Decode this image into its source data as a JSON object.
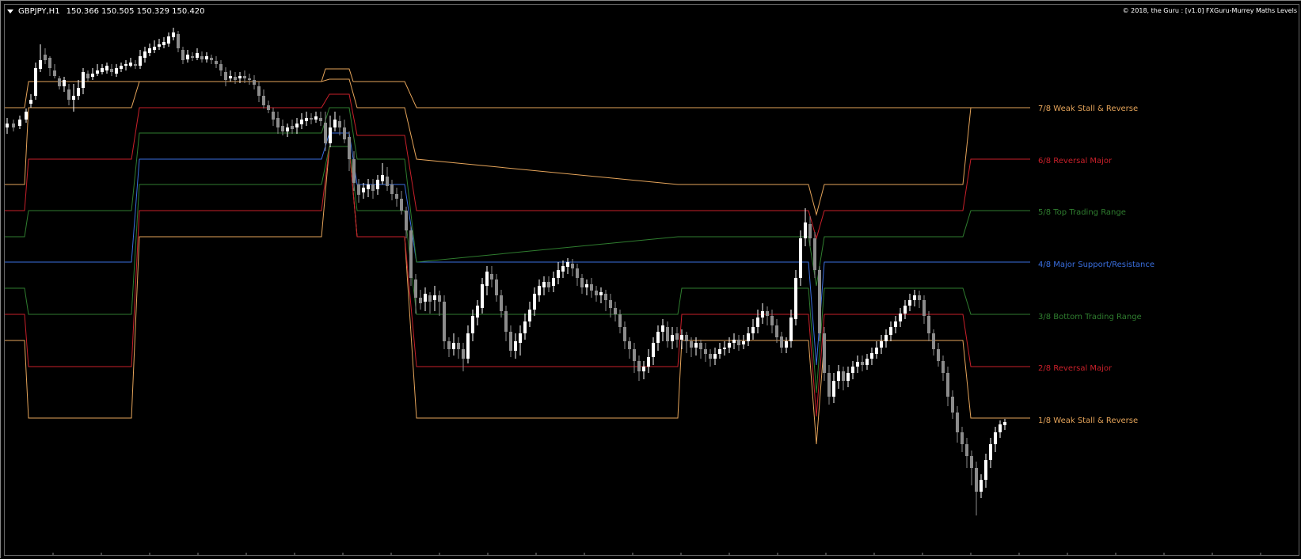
{
  "header": {
    "symbol": "GBPJPY,H1",
    "quotes": "150.366 150.505 150.329 150.420",
    "copyright": "© 2018, the Guru : [v1.0] FXGuru-Murrey Maths Levels"
  },
  "colors": {
    "background": "#000000",
    "bull_candle": "#ffffff",
    "bear_candle": "#8c8c8c",
    "weak": "#e5a45a",
    "reversal": "#c8202a",
    "trading_range": "#2f7d2f",
    "major": "#3a6fe0"
  },
  "chart_data": {
    "type": "candlestick",
    "symbol": "GBPJPY",
    "timeframe": "H1",
    "price_range": [
      0,
      100
    ],
    "note_scale": "price in relative units",
    "levels": [
      {
        "key": "8",
        "name": "",
        "color": "#e5a45a",
        "segments": [
          [
            0,
            60
          ],
          [
            160,
            72
          ],
          [
            460,
            100
          ],
          [
            490,
            90
          ],
          [
            740,
            60
          ],
          [
            1220,
            72
          ]
        ]
      },
      {
        "key": "7",
        "label": "7/8 Weak Stall & Reverse",
        "color": "#e5a45a",
        "segments": [
          [
            0,
            55
          ],
          [
            160,
            67
          ],
          [
            405,
            90
          ],
          [
            490,
            77
          ],
          [
            800,
            55
          ],
          [
            980,
            62
          ],
          [
            1220,
            67
          ]
        ]
      },
      {
        "key": "6",
        "label": "6/8 Reversal Major",
        "color": "#c8202a",
        "segments": [
          [
            0,
            50
          ],
          [
            160,
            60
          ],
          [
            405,
            80
          ],
          [
            490,
            70
          ],
          [
            800,
            50
          ],
          [
            980,
            55
          ],
          [
            1220,
            60
          ]
        ]
      },
      {
        "key": "5",
        "label": "5/8 Top Trading Range",
        "color": "#2f7d2f",
        "segments": [
          [
            0,
            45
          ],
          [
            160,
            55
          ],
          [
            405,
            70
          ],
          [
            490,
            55
          ],
          [
            800,
            45
          ],
          [
            980,
            50
          ],
          [
            1220,
            55
          ]
        ]
      },
      {
        "key": "4",
        "label": "4/8 Major Support/Resistance",
        "color": "#3a6fe0",
        "segments": [
          [
            0,
            40
          ],
          [
            160,
            50
          ],
          [
            405,
            60
          ],
          [
            490,
            40
          ],
          [
            980,
            40
          ]
        ]
      },
      {
        "key": "3",
        "label": "3/8 Bottom Trading Range",
        "color": "#2f7d2f",
        "segments": [
          [
            0,
            35
          ],
          [
            160,
            45
          ],
          [
            405,
            50
          ],
          [
            490,
            35
          ],
          [
            800,
            30
          ],
          [
            980,
            35
          ],
          [
            1220,
            30
          ]
        ]
      },
      {
        "key": "2",
        "label": "2/8 Reversal Major",
        "color": "#c8202a",
        "segments": [
          [
            0,
            30
          ],
          [
            160,
            40
          ],
          [
            405,
            40
          ],
          [
            490,
            25
          ],
          [
            800,
            20
          ],
          [
            980,
            25
          ],
          [
            1220,
            20
          ]
        ]
      },
      {
        "key": "1",
        "label": "1/8 Weak Stall & Reverse",
        "color": "#e5a45a",
        "segments": [
          [
            0,
            25
          ],
          [
            160,
            35
          ],
          [
            405,
            30
          ],
          [
            490,
            15
          ],
          [
            800,
            10
          ],
          [
            980,
            15
          ],
          [
            1220,
            10
          ]
        ]
      }
    ]
  },
  "levels_display": [
    {
      "label": "7/8 Weak Stall & Reverse",
      "color": "#e5a45a"
    },
    {
      "label": "6/8 Reversal Major",
      "color": "#c8202a"
    },
    {
      "label": "5/8 Top Trading Range",
      "color": "#2f7d2f"
    },
    {
      "label": "4/8 Major Support/Resistance",
      "color": "#3a6fe0"
    },
    {
      "label": "3/8 Bottom Trading Range",
      "color": "#2f7d2f"
    },
    {
      "label": "2/8 Reversal Major",
      "color": "#c8202a"
    },
    {
      "label": "1/8 Weak Stall & Reverse",
      "color": "#e5a45a"
    }
  ]
}
